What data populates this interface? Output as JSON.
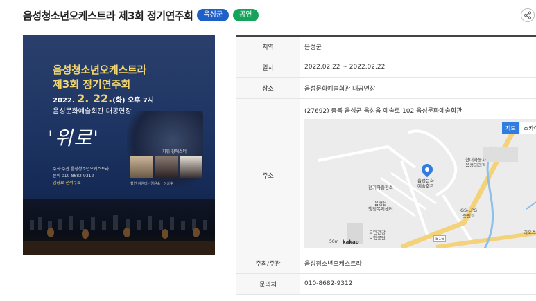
{
  "header": {
    "title": "음성청소년오케스트라 제3회 정기연주회",
    "badge_region": "음성군",
    "badge_category": "공연",
    "share_icon": "share-icon"
  },
  "poster": {
    "title_line1": "음성청소년오케스트라",
    "title_line2": "제3회 정기연주회",
    "date_prefix": "2022.",
    "date_big": "2. 22.",
    "date_suffix": "(화) 오후 7시",
    "venue": "음성문화예술회관 대공연장",
    "theme": "'위로'",
    "conductor_label": "지휘 장에스더",
    "info_lines": [
      "주최·주관  음성청소년오케스트라",
      "문의  010-8682-9312",
      "입장료  전석무료"
    ],
    "soloists_label": "협연 김완태 · 임윤숙 · 이상후"
  },
  "table": {
    "rows": [
      {
        "label": "지역",
        "value": "음성군"
      },
      {
        "label": "일시",
        "value": "2022.02.22 ~ 2022.02.22"
      },
      {
        "label": "장소",
        "value": "음성문화예술회관 대공연장"
      },
      {
        "label": "주소",
        "value": "(27692) 충북 음성군 음성읍 예술로 102 음성문화예술회관"
      },
      {
        "label": "주최/주관",
        "value": "음성청소년오케스트라"
      },
      {
        "label": "문의처",
        "value": "010-8682-9312"
      }
    ]
  },
  "map": {
    "btn_map": "지도",
    "btn_sky": "스카이",
    "labels": {
      "hyundai": "현대자동차\n음성대리점",
      "venue": "음성문화\n예술회관",
      "electric": "전기차충전소",
      "welfare": "음성읍\n행정복지센터",
      "gs": "GS-LPG\n충전소",
      "health": "국민건강\n보험공단",
      "leos": "리오스",
      "road": "516"
    },
    "scale": "50m",
    "kakao": "kakao"
  }
}
